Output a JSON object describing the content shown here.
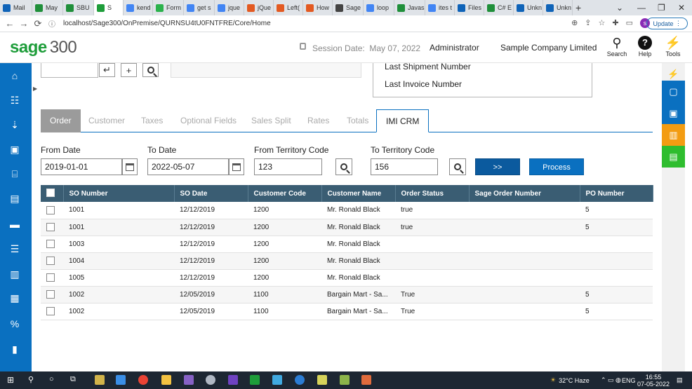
{
  "browser": {
    "tabs": [
      {
        "label": "Mail",
        "color": "#0f63b8"
      },
      {
        "label": "May",
        "color": "#1f8f3a"
      },
      {
        "label": "SBU",
        "color": "#1f8f3a"
      },
      {
        "label": "S",
        "color": "#1e9d3a",
        "active": true
      },
      {
        "label": "kend",
        "color": "#4285f4"
      },
      {
        "label": "Form",
        "color": "#2bb24c"
      },
      {
        "label": "get s",
        "color": "#4285f4"
      },
      {
        "label": "jque",
        "color": "#4285f4"
      },
      {
        "label": "jQue",
        "color": "#e35a22"
      },
      {
        "label": "Left(",
        "color": "#e35a22"
      },
      {
        "label": "How",
        "color": "#e35a22"
      },
      {
        "label": "Sage",
        "color": "#444444"
      },
      {
        "label": "loop",
        "color": "#4285f4"
      },
      {
        "label": "Javas",
        "color": "#1f8f3a"
      },
      {
        "label": "ites t",
        "color": "#4285f4"
      },
      {
        "label": "Files",
        "color": "#0f63b8"
      },
      {
        "label": "C# E",
        "color": "#1f8f3a"
      },
      {
        "label": "Unkn",
        "color": "#0f63b8"
      },
      {
        "label": "Unkn",
        "color": "#0f63b8"
      }
    ],
    "url": "localhost/Sage300/OnPremise/QURNSU4tU0FNTFRE/Core/Home",
    "update_label": "Update",
    "avatar_letter": "s"
  },
  "header": {
    "logo_brand": "sage",
    "logo_number": "300",
    "session_label": "Session Date:",
    "session_date": "May 07, 2022",
    "user": "Administrator",
    "company": "Sample Company Limited",
    "search_label": "Search",
    "help_label": "Help",
    "tools_label": "Tools"
  },
  "info_panel": {
    "line1": "Last Shipment Number",
    "line2": "Last Invoice Number"
  },
  "tabs": [
    {
      "label": "Order"
    },
    {
      "label": "Customer"
    },
    {
      "label": "Taxes"
    },
    {
      "label": "Optional Fields"
    },
    {
      "label": "Sales Split"
    },
    {
      "label": "Rates"
    },
    {
      "label": "Totals"
    },
    {
      "label": "IMI CRM"
    }
  ],
  "filters": {
    "from_date_label": "From Date",
    "from_date_value": "2019-01-01",
    "to_date_label": "To Date",
    "to_date_value": "2022-05-07",
    "from_territory_label": "From Territory Code",
    "from_territory_value": "123",
    "to_territory_label": "To Territory Code",
    "to_territory_value": "156",
    "next_label": ">>",
    "process_label": "Process"
  },
  "grid": {
    "columns": [
      "SO Number",
      "SO Date",
      "Customer Code",
      "Customer Name",
      "Order Status",
      "Sage Order Number",
      "PO Number"
    ],
    "rows": [
      [
        "1001",
        "12/12/2019",
        "1200",
        "Mr. Ronald Black",
        "true",
        "",
        "5"
      ],
      [
        "1001",
        "12/12/2019",
        "1200",
        "Mr. Ronald Black",
        "true",
        "",
        "5"
      ],
      [
        "1003",
        "12/12/2019",
        "1200",
        "Mr. Ronald Black",
        "",
        "",
        ""
      ],
      [
        "1004",
        "12/12/2019",
        "1200",
        "Mr. Ronald Black",
        "",
        "",
        ""
      ],
      [
        "1005",
        "12/12/2019",
        "1200",
        "Mr. Ronald Black",
        "",
        "",
        ""
      ],
      [
        "1002",
        "12/05/2019",
        "1100",
        "Bargain Mart - Sa...",
        "True",
        "",
        "5"
      ],
      [
        "1002",
        "12/05/2019",
        "1100",
        "Bargain Mart - Sa...",
        "True",
        "",
        "5"
      ]
    ]
  },
  "taskbar": {
    "weather": "32°C  Haze",
    "lang": "ENG",
    "time": "16:55",
    "date": "07-05-2022"
  }
}
